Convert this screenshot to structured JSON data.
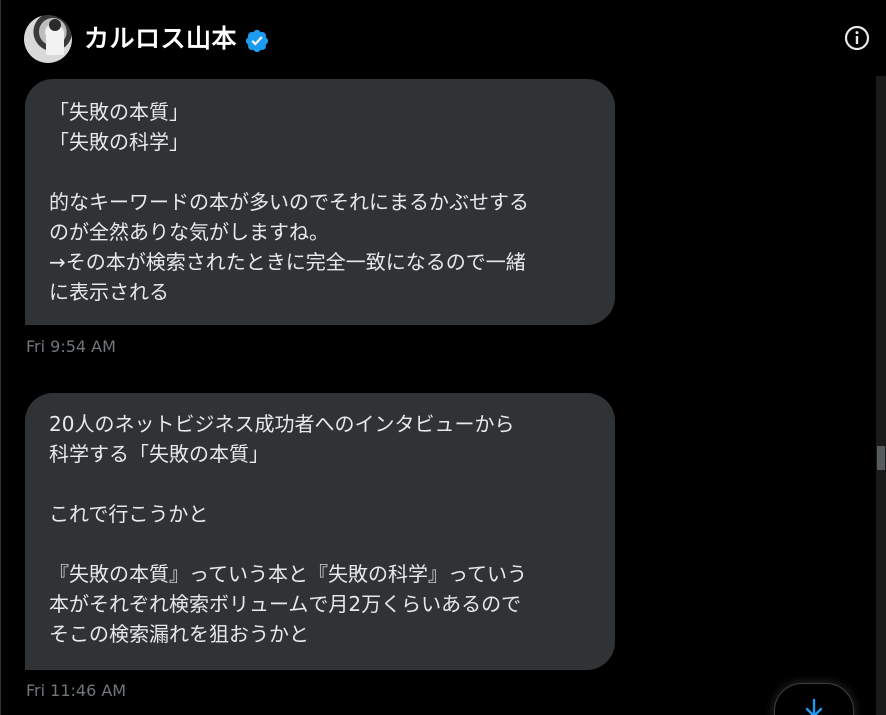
{
  "header": {
    "name": "カルロス山本",
    "verified_icon": "verified-badge-icon",
    "info_icon": "info-icon"
  },
  "messages": [
    {
      "lines": [
        "「失敗の本質」",
        "「失敗の科学」",
        "",
        "的なキーワードの本が多いのでそれにまるかぶせする",
        "のが全然ありな気がしますね。",
        "→その本が検索されたときに完全一致になるので一緒",
        "に表示される"
      ],
      "timestamp": "Fri 9:54 AM"
    },
    {
      "lines": [
        "20人のネットビジネス成功者へのインタビューから",
        "科学する「失敗の本質」",
        "",
        "これで行こうかと",
        "",
        "『失敗の本質』っていう本と『失敗の科学』っていう",
        "本がそれぞれ検索ボリュームで月2万くらいあるので",
        "そこの検索漏れを狙おうかと"
      ],
      "timestamp": "Fri 11:46 AM"
    }
  ],
  "colors": {
    "background": "#000000",
    "bubble": "#2f3336",
    "text": "#e7e9ea",
    "muted": "#71767b",
    "verified": "#1d9bf0"
  },
  "scroll_down_icon": "arrow-down-icon"
}
